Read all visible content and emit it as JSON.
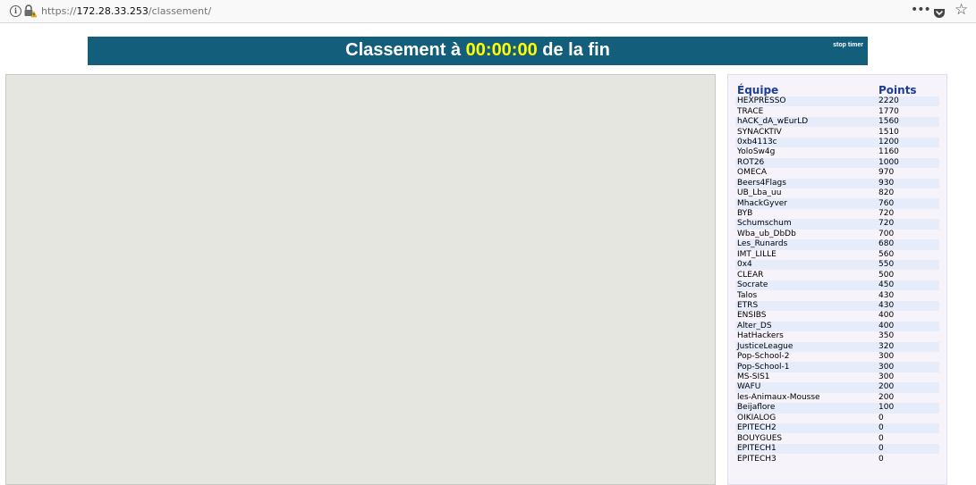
{
  "browser": {
    "url_prefix": "https://",
    "url_host": "172.28.33.253",
    "url_path": "/classement/",
    "more_glyph": "•••",
    "star_glyph": "☆"
  },
  "banner": {
    "title_before": "Classement à ",
    "timer": "00:00:00",
    "title_after": " de la fin",
    "stop_timer": "stop timer",
    "background": "#135f7b",
    "timer_color": "#ffff00"
  },
  "scoreboard": {
    "header_team": "Équipe",
    "header_points": "Points",
    "rows": [
      {
        "team": "HEXPRESSO",
        "points": "2220"
      },
      {
        "team": "TRACE",
        "points": "1770"
      },
      {
        "team": "hACK_dA_wEurLD",
        "points": "1560"
      },
      {
        "team": "SYNACKTIV",
        "points": "1510"
      },
      {
        "team": "0xb4113c",
        "points": "1200"
      },
      {
        "team": "YoloSw4g",
        "points": "1160"
      },
      {
        "team": "ROT26",
        "points": "1000"
      },
      {
        "team": "OMECA",
        "points": "970"
      },
      {
        "team": "Beers4Flags",
        "points": "930"
      },
      {
        "team": "UB_Lba_uu",
        "points": "820"
      },
      {
        "team": "MhackGyver",
        "points": "760"
      },
      {
        "team": "BYB",
        "points": "720"
      },
      {
        "team": "Schumschum",
        "points": "720"
      },
      {
        "team": "Wba_ub_DbDb",
        "points": "700"
      },
      {
        "team": "Les_Runards",
        "points": "680"
      },
      {
        "team": "IMT_LILLE",
        "points": "560"
      },
      {
        "team": "0x4",
        "points": "550"
      },
      {
        "team": "CLEAR",
        "points": "500"
      },
      {
        "team": "Socrate",
        "points": "450"
      },
      {
        "team": "Talos",
        "points": "430"
      },
      {
        "team": "ETRS",
        "points": "430"
      },
      {
        "team": "ENSIBS",
        "points": "400"
      },
      {
        "team": "Alter_DS",
        "points": "400"
      },
      {
        "team": "HatHackers",
        "points": "350"
      },
      {
        "team": "JusticeLeague",
        "points": "320"
      },
      {
        "team": "Pop-School-2",
        "points": "300"
      },
      {
        "team": "Pop-School-1",
        "points": "300"
      },
      {
        "team": "MS-SIS1",
        "points": "300"
      },
      {
        "team": "WAFU",
        "points": "200"
      },
      {
        "team": "les-Animaux-Mousse",
        "points": "200"
      },
      {
        "team": "Beijaflore",
        "points": "100"
      },
      {
        "team": "OIKIALOG",
        "points": "0"
      },
      {
        "team": "EPITECH2",
        "points": "0"
      },
      {
        "team": "BOUYGUES",
        "points": "0"
      },
      {
        "team": "EPITECH1",
        "points": "0"
      },
      {
        "team": "EPITECH3",
        "points": "0"
      }
    ]
  }
}
